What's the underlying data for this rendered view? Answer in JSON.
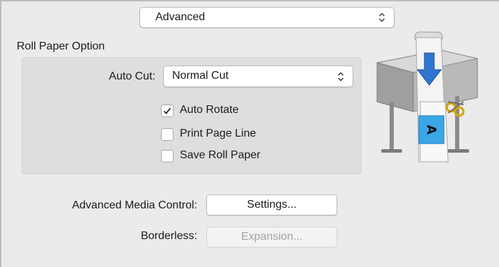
{
  "print_dialog": {
    "mode_popup": {
      "value": "Advanced"
    },
    "roll_paper_section": {
      "title": "Roll Paper Option",
      "auto_cut": {
        "label": "Auto Cut:",
        "value": "Normal Cut"
      },
      "checkboxes": [
        {
          "label": "Auto Rotate",
          "checked": true
        },
        {
          "label": "Print Page Line",
          "checked": false
        },
        {
          "label": "Save Roll Paper",
          "checked": false
        }
      ]
    },
    "advanced_media_control": {
      "label": "Advanced Media Control:",
      "button": "Settings..."
    },
    "borderless": {
      "label": "Borderless:",
      "button": "Expansion...",
      "enabled": false
    },
    "illustration": {
      "page_letter": "A"
    }
  }
}
